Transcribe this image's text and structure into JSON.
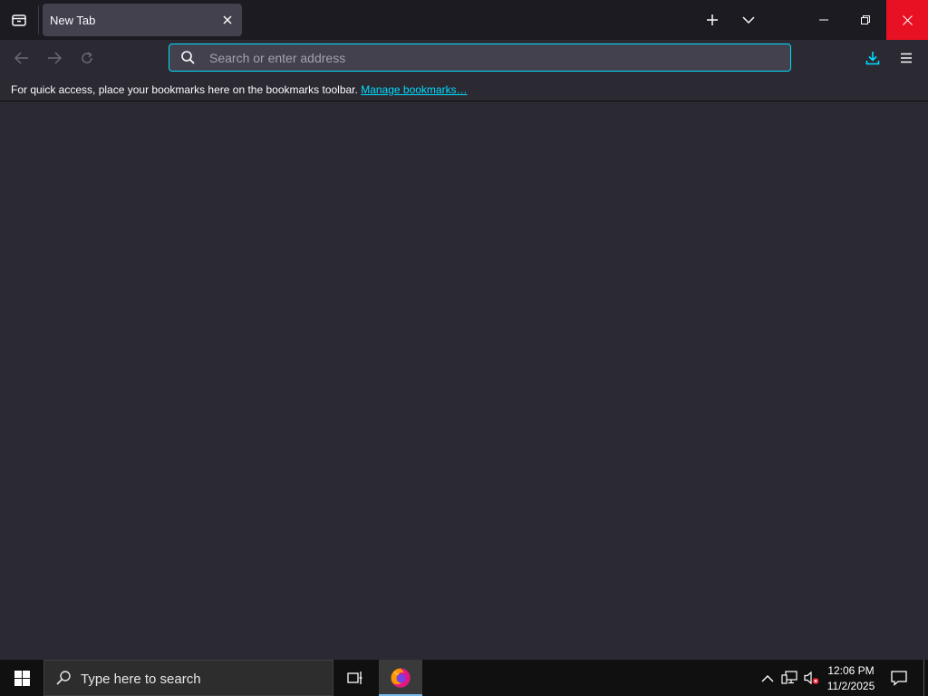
{
  "browser": {
    "tab": {
      "title": "New Tab"
    },
    "urlbar": {
      "placeholder": "Search or enter address",
      "value": ""
    },
    "bookmarks_toolbar": {
      "message": "For quick access, place your bookmarks here on the bookmarks toolbar.",
      "manage_link": "Manage bookmarks…"
    },
    "colors": {
      "accent": "#00ddff",
      "close_button": "#e81123"
    }
  },
  "taskbar": {
    "search_placeholder": "Type here to search",
    "time": "12:06 PM",
    "date": "11/2/2025"
  },
  "icons": [
    "list-all-tabs-icon",
    "close-tab-icon",
    "new-tab-icon",
    "chevron-down-icon",
    "minimize-icon",
    "restore-icon",
    "close-window-icon",
    "back-icon",
    "forward-icon",
    "reload-icon",
    "search-icon",
    "downloads-icon",
    "menu-icon",
    "windows-start-icon",
    "taskbar-search-icon",
    "task-view-icon",
    "firefox-icon",
    "chevron-up-icon",
    "network-icon",
    "volume-muted-icon",
    "notifications-icon"
  ]
}
